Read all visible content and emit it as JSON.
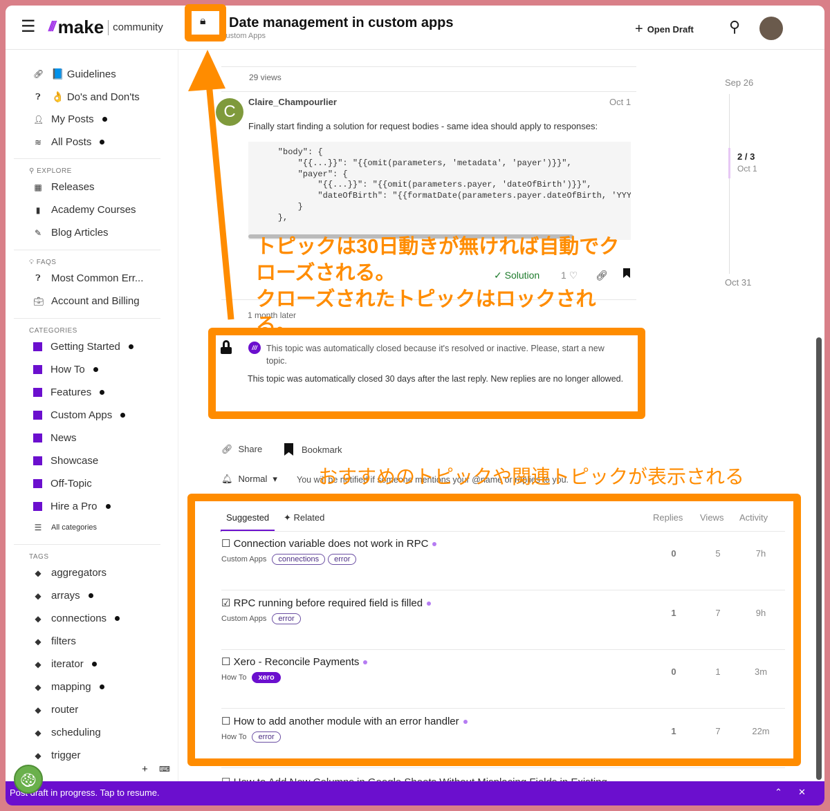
{
  "header": {
    "logo": "make",
    "logo_sub": "community",
    "title": "Date management in custom apps",
    "category": "Custom Apps",
    "open_draft": "Open Draft"
  },
  "sidebar": {
    "top": [
      {
        "icon": "link-icon",
        "label": "📘 Guidelines",
        "dot": false
      },
      {
        "icon": "question-icon",
        "label": "👌 Do's and Don'ts",
        "dot": false
      },
      {
        "icon": "user-icon",
        "label": "My Posts",
        "dot": true
      },
      {
        "icon": "layers-icon",
        "label": "All Posts",
        "dot": true
      }
    ],
    "explore_title": "EXPLORE",
    "explore": [
      "Releases",
      "Academy Courses",
      "Blog Articles"
    ],
    "faqs_title": "FAQS",
    "faqs": [
      "Most Common Err...",
      "Account and Billing"
    ],
    "categories_title": "CATEGORIES",
    "categories": [
      {
        "label": "Getting Started",
        "dot": true
      },
      {
        "label": "How To",
        "dot": true
      },
      {
        "label": "Features",
        "dot": true
      },
      {
        "label": "Custom Apps",
        "dot": true
      },
      {
        "label": "News",
        "dot": false
      },
      {
        "label": "Showcase",
        "dot": false
      },
      {
        "label": "Off-Topic",
        "dot": false
      },
      {
        "label": "Hire a Pro",
        "dot": true
      }
    ],
    "all_categories": "All categories",
    "tags_title": "TAGS",
    "tags": [
      {
        "label": "aggregators",
        "dot": false
      },
      {
        "label": "arrays",
        "dot": true
      },
      {
        "label": "connections",
        "dot": true
      },
      {
        "label": "filters",
        "dot": false
      },
      {
        "label": "iterator",
        "dot": true
      },
      {
        "label": "mapping",
        "dot": true
      },
      {
        "label": "router",
        "dot": false
      },
      {
        "label": "scheduling",
        "dot": false
      },
      {
        "label": "trigger",
        "dot": false
      }
    ]
  },
  "post": {
    "views": "29 views",
    "author": "Claire_Champourlier",
    "avatar_letter": "C",
    "date": "Oct 1",
    "text": "Finally start finding a solution for request bodies - same idea should apply to responses:",
    "code": "    \"body\": {\n        \"{{...}}\": \"{{omit(parameters, 'metadata', 'payer')}}\",\n        \"payer\": {\n            \"{{...}}\": \"{{omit(parameters.payer, 'dateOfBirth')}}\",\n            \"dateOfBirth\": \"{{formatDate(parameters.payer.dateOfBirth, 'YYY\n        }\n    },",
    "solution": "Solution",
    "likes": "1",
    "time_gap": "1 month later"
  },
  "closed": {
    "notice": "This topic was automatically closed because it's resolved or inactive. Please, start a new topic.",
    "message": "This topic was automatically closed 30 days after the last reply. New replies are no longer allowed."
  },
  "actions": {
    "share": "Share",
    "bookmark": "Bookmark",
    "notify_level": "Normal",
    "notify_text": "You will be notified if someone mentions your @name or replies to you."
  },
  "timeline": {
    "start": "Sep 26",
    "position": "2 / 3",
    "position_date": "Oct 1",
    "end": "Oct 31"
  },
  "suggested": {
    "tabs": [
      "Suggested",
      "Related"
    ],
    "columns": [
      "Replies",
      "Views",
      "Activity"
    ],
    "rows": [
      {
        "title": "Connection variable does not work in RPC",
        "category": "Custom Apps",
        "tags": [
          "connections",
          "error"
        ],
        "replies": "0",
        "views": "5",
        "activity": "7h",
        "solved": false
      },
      {
        "title": "RPC running before required field is filled",
        "category": "Custom Apps",
        "tags": [
          "error"
        ],
        "replies": "1",
        "views": "7",
        "activity": "9h",
        "solved": true
      },
      {
        "title": "Xero - Reconcile Payments",
        "category": "How To",
        "tags": [
          "xero"
        ],
        "replies": "0",
        "views": "1",
        "activity": "3m",
        "solved": false
      },
      {
        "title": "How to add another module with an error handler",
        "category": "How To",
        "tags": [
          "error"
        ],
        "replies": "1",
        "views": "7",
        "activity": "22m",
        "solved": false
      }
    ],
    "next_row": "How to Add New Columns in Google Sheets Without Misplacing Fields in Existing"
  },
  "draft_bar": "Post draft in progress. Tap to resume.",
  "annotations": {
    "note1": "トピックは30日動きが無ければ自動でクローズされる。",
    "note2": "クローズされたトピックはロックされる。",
    "note3": "おすすめのトピックや関連トピックが表示される"
  },
  "colors": {
    "accent": "#6b0fce",
    "annotation": "#ff8c00",
    "frame": "#d97f88"
  }
}
